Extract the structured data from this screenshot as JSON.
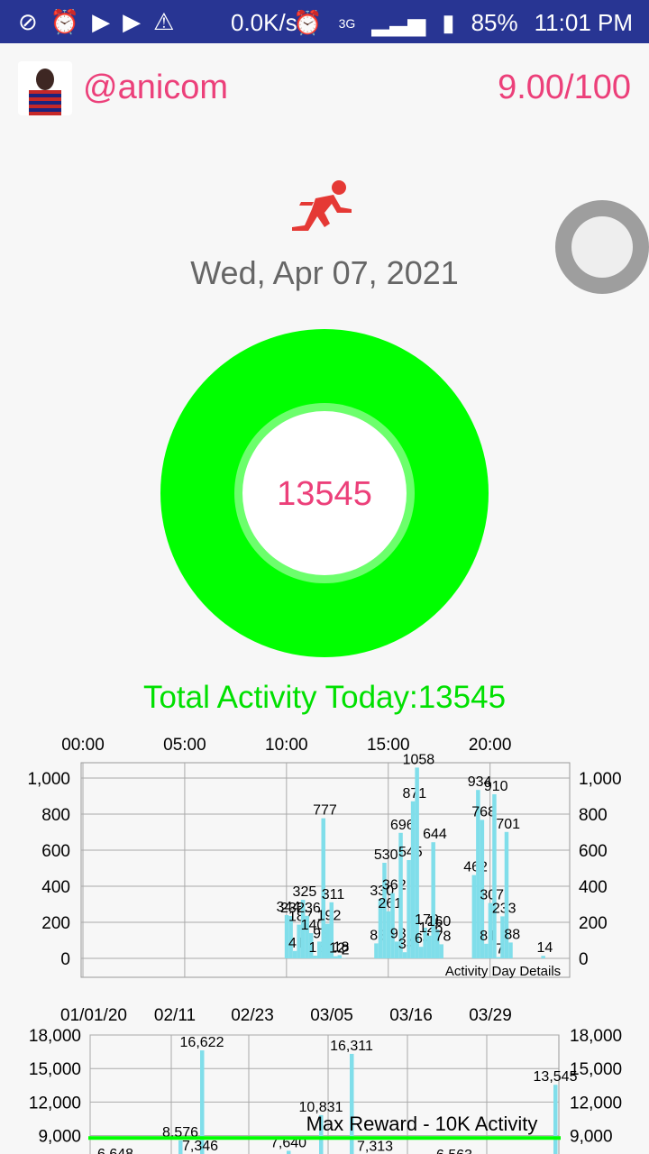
{
  "status_bar": {
    "icons": [
      "brush-icon",
      "alarm-icon",
      "youtube-icon",
      "youtube-icon",
      "warning-icon"
    ],
    "speed": "0.0K/s",
    "network": "3G",
    "battery": "85%",
    "time": "11:01 PM"
  },
  "header": {
    "username": "@anicom",
    "score": "9.00/100"
  },
  "date": "Wed, Apr 07, 2021",
  "ring": {
    "count": "13545",
    "color": "#00ff00"
  },
  "total_label": "Total Activity Today:13545",
  "colors": {
    "accent": "#ec407a",
    "bar": "#80deea",
    "reward": "#00ff00",
    "status_bar": "#283593"
  },
  "chart_data": [
    {
      "type": "bar",
      "title": "Activity Day Details",
      "x_ticks": [
        "00:00",
        "05:00",
        "10:00",
        "15:00",
        "20:00"
      ],
      "y_ticks": [
        "0",
        "200",
        "400",
        "600",
        "800",
        "1,000"
      ],
      "ylim": [
        0,
        1100
      ],
      "bar_labels": [
        {
          "label": "344"
        },
        {
          "label": "235"
        },
        {
          "label": "41"
        },
        {
          "label": "187"
        },
        {
          "label": "325"
        },
        {
          "label": "236"
        },
        {
          "label": "140"
        },
        {
          "label": "15"
        },
        {
          "label": "93"
        },
        {
          "label": "777"
        },
        {
          "label": "192"
        },
        {
          "label": "311"
        },
        {
          "label": "12"
        },
        {
          "label": "18"
        },
        {
          "label": "2"
        },
        {
          "label": "83"
        },
        {
          "label": "330"
        },
        {
          "label": "530"
        },
        {
          "label": "261"
        },
        {
          "label": "362"
        },
        {
          "label": "93"
        },
        {
          "label": "696"
        },
        {
          "label": "34"
        },
        {
          "label": "545"
        },
        {
          "label": "871"
        },
        {
          "label": "1058"
        },
        {
          "label": "64"
        },
        {
          "label": "170"
        },
        {
          "label": "126"
        },
        {
          "label": "644"
        },
        {
          "label": "160"
        },
        {
          "label": "78"
        },
        {
          "label": "462"
        },
        {
          "label": "934"
        },
        {
          "label": "768"
        },
        {
          "label": "81"
        },
        {
          "label": "307"
        },
        {
          "label": "910"
        },
        {
          "label": "7"
        },
        {
          "label": "233"
        },
        {
          "label": "701"
        },
        {
          "label": "88"
        },
        {
          "label": "14"
        }
      ],
      "values": [
        240,
        235,
        41,
        187,
        325,
        236,
        140,
        15,
        93,
        777,
        192,
        311,
        12,
        18,
        2,
        83,
        330,
        530,
        261,
        362,
        93,
        696,
        34,
        545,
        871,
        1058,
        64,
        170,
        126,
        644,
        160,
        78,
        462,
        934,
        768,
        81,
        307,
        910,
        7,
        233,
        701,
        88,
        14
      ],
      "x_hours": [
        10.0,
        10.2,
        10.4,
        10.6,
        10.8,
        11.0,
        11.2,
        11.4,
        11.6,
        11.8,
        12.0,
        12.2,
        12.4,
        12.6,
        12.8,
        14.4,
        14.6,
        14.8,
        15.0,
        15.2,
        15.4,
        15.6,
        15.8,
        16.0,
        16.2,
        16.4,
        16.6,
        16.8,
        17.0,
        17.2,
        17.4,
        17.6,
        19.2,
        19.4,
        19.6,
        19.8,
        20.0,
        20.2,
        20.4,
        20.6,
        20.8,
        21.0,
        22.6
      ]
    },
    {
      "type": "bar",
      "title": "Max Reward - 10K Activity",
      "x_ticks": [
        "01/01/20",
        "02/11",
        "02/23",
        "03/05",
        "03/16",
        "03/29"
      ],
      "y_ticks": [
        "9,000",
        "12,000",
        "15,000",
        "18,000"
      ],
      "ylim": [
        6000,
        18000
      ],
      "reference_line": 10000,
      "visible_labels": [
        "16,622",
        "16,311",
        "13,545",
        "10,831",
        "8,576",
        "7,313",
        "6,563",
        "6,648",
        "7,346",
        "7,640"
      ]
    }
  ]
}
